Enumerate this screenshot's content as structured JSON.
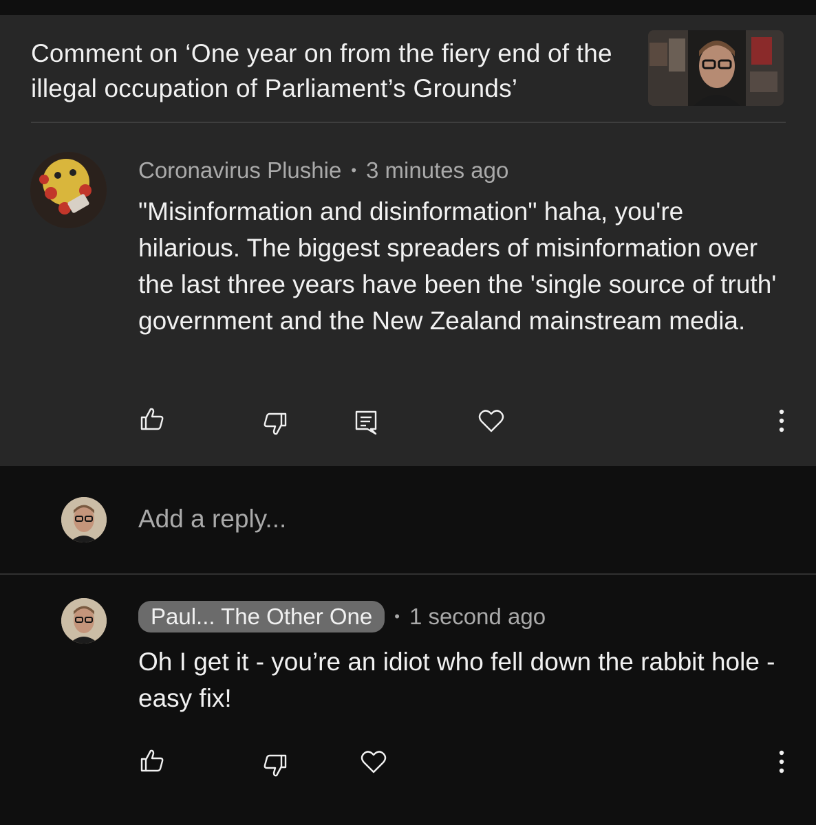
{
  "header": {
    "title": "Comment on ‘One year on from the fiery end of the illegal occupation of Parliament’s Grounds’"
  },
  "comment": {
    "author": "Coronavirus Plushie",
    "separator": "•",
    "time": "3 minutes ago",
    "text": "\"Misinformation and disinformation\" haha, you're hilarious. The biggest spreaders of misinformation over the last three years have been the 'single source of truth' government and the New Zealand mainstream media."
  },
  "reply_box": {
    "placeholder": "Add a reply..."
  },
  "reply": {
    "author": "Paul... The Other One",
    "separator": "•",
    "time": "1 second ago",
    "text": "Oh I get it - you’re an idiot who fell down the rabbit hole - easy fix!"
  },
  "icons": {
    "like": "thumbs-up-icon",
    "dislike": "thumbs-down-icon",
    "reply": "comment-icon",
    "heart": "heart-icon",
    "more": "more-vertical-icon"
  }
}
